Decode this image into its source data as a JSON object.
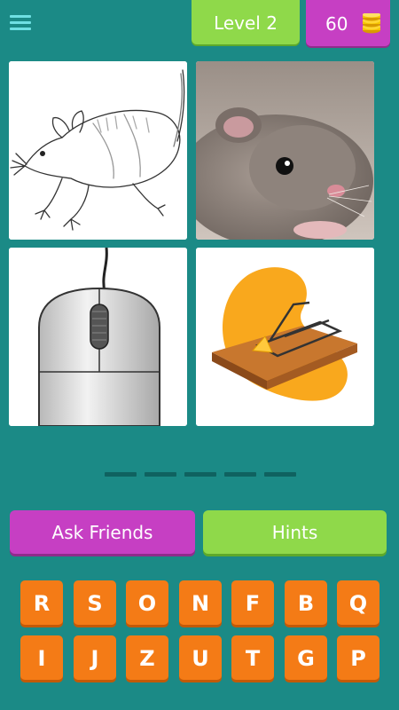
{
  "header": {
    "menu_icon": "hamburger-menu-icon",
    "level_label": "Level 2",
    "coins": "60",
    "coin_icon": "coin-stack-icon"
  },
  "pictures": [
    {
      "subject": "mouse-sketch"
    },
    {
      "subject": "mouse-photo"
    },
    {
      "subject": "computer-mouse"
    },
    {
      "subject": "mouse-trap"
    }
  ],
  "answer": {
    "length": 5
  },
  "buttons": {
    "ask_friends": "Ask Friends",
    "hints": "Hints"
  },
  "keyboard": {
    "row1": [
      "R",
      "S",
      "O",
      "N",
      "F",
      "B",
      "Q"
    ],
    "row2": [
      "I",
      "J",
      "Z",
      "U",
      "T",
      "G",
      "P"
    ]
  },
  "colors": {
    "background": "#1b8a86",
    "green": "#8fd94a",
    "purple": "#c63fc3",
    "orange": "#f47b16"
  }
}
